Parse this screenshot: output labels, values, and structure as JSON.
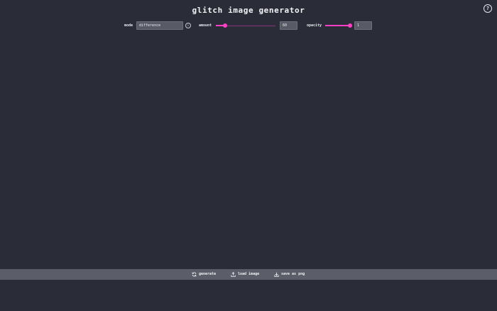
{
  "header": {
    "title": "glitch image generator",
    "help_icon_glyph": "?"
  },
  "controls": {
    "mode": {
      "label": "mode",
      "value": "difference",
      "info_icon_glyph": "i"
    },
    "amount": {
      "label": "amount",
      "value": "60",
      "slider_fraction": 0.15
    },
    "opacity": {
      "label": "opacity",
      "value": "1",
      "slider_fraction": 1.0
    }
  },
  "toolbar": {
    "generate_label": "generate",
    "load_image_label": "load image",
    "save_label": "save as png"
  },
  "colors": {
    "background": "#2a2c38",
    "toolbar": "#5b5d68",
    "accent": "#ff3fc6",
    "field": "#585a66"
  },
  "icons": {
    "help": "question-circle-icon",
    "info": "info-circle-icon",
    "generate": "refresh-icon",
    "load": "upload-icon",
    "save": "download-icon"
  }
}
